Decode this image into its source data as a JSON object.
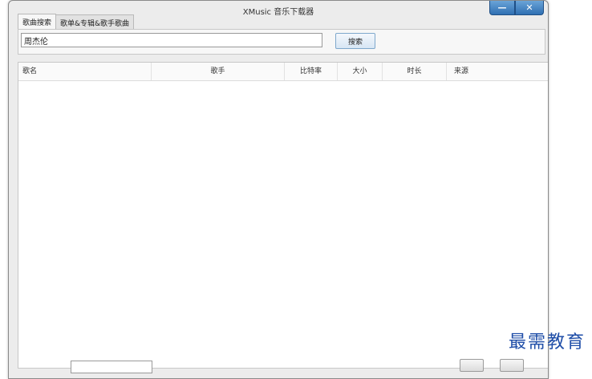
{
  "window": {
    "title": "XMusic 音乐下载器"
  },
  "window_controls": {
    "minimize": "—",
    "close": "✕"
  },
  "tabs": [
    {
      "label": "歌曲搜索"
    },
    {
      "label": "歌单&专辑&歌手歌曲"
    }
  ],
  "search": {
    "value": "周杰伦",
    "button_label": "搜索"
  },
  "table": {
    "columns": [
      "歌名",
      "歌手",
      "比特率",
      "大小",
      "时长",
      "来源"
    ],
    "rows": []
  },
  "watermark": "最需教育",
  "colors": {
    "window_button": "#3a7cc0",
    "watermark": "#1f4ea8"
  }
}
